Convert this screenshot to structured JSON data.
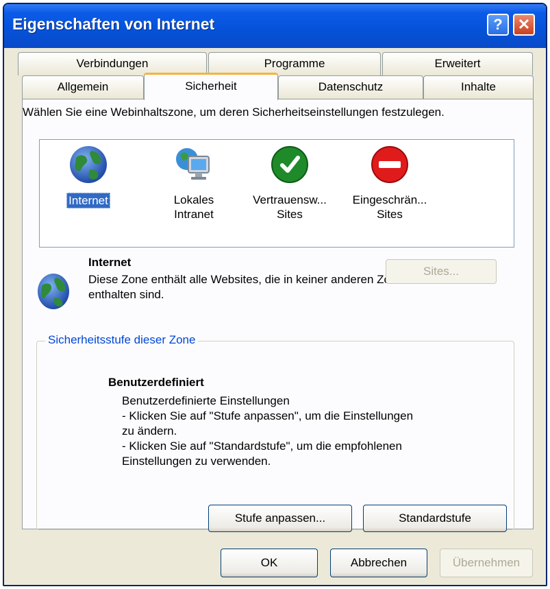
{
  "window": {
    "title": "Eigenschaften von Internet",
    "help_label": "?",
    "close_label": "✕"
  },
  "tabs": {
    "row_back": [
      "Verbindungen",
      "Programme",
      "Erweitert"
    ],
    "row_front": [
      "Allgemein",
      "Sicherheit",
      "Datenschutz",
      "Inhalte"
    ],
    "active": "Sicherheit"
  },
  "security": {
    "intro": "Wählen Sie eine Webinhaltszone, um deren Sicherheitseinstellungen festzulegen.",
    "zones": [
      {
        "label": "Internet",
        "icon": "globe-icon"
      },
      {
        "label": "Lokales\nIntranet",
        "icon": "network-computer-icon"
      },
      {
        "label": "Vertrauensw...\nSites",
        "icon": "checkmark-icon"
      },
      {
        "label": "Eingeschrän...\nSites",
        "icon": "no-entry-icon"
      }
    ],
    "selected_zone": "Internet",
    "info_title": "Internet",
    "info_text": "Diese Zone enthält alle Websites, die in keiner anderen Zone enthalten sind.",
    "sites_label": "Sites...",
    "level_group_label": "Sicherheitsstufe dieser Zone",
    "level_title": "Benutzerdefiniert",
    "level_desc_1": "Benutzerdefinierte Einstellungen",
    "level_desc_2": "- Klicken Sie auf \"Stufe anpassen\", um die Einstellungen zu ändern.",
    "level_desc_3": "- Klicken Sie auf \"Standardstufe\", um die empfohlenen Einstellungen zu verwenden.",
    "custom_level_label": "Stufe anpassen...",
    "default_level_label": "Standardstufe"
  },
  "footer": {
    "ok_label": "OK",
    "cancel_label": "Abbrechen",
    "apply_label": "Übernehmen"
  },
  "colors": {
    "titlebar": "#0552d8",
    "selection": "#316ac5",
    "tab_highlight": "#f7b33d",
    "group_label": "#0046d5"
  }
}
